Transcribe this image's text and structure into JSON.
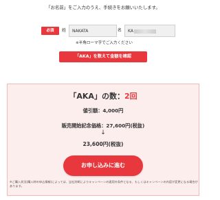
{
  "intro": "「お名前」をご入力のうえ、手続きをお願いいたします。",
  "name_form": {
    "required_badge": "必須",
    "sei_label": "姓",
    "sei_value": "NAKATA",
    "mei_label": "名",
    "mei_value": "KA",
    "note": "※半角ローマ字でご入力ください"
  },
  "count_button": "「AKA」を数えて金額を確認",
  "result": {
    "title_prefix": "「AKA」の数：",
    "count": "2回",
    "discount": "値引額：4,000円",
    "launch_price": "販売開始記念価格：27,600円(税抜)",
    "arrow": "↓",
    "final_price": "23,600円(税抜)",
    "apply_button": "お申し込みに進む",
    "disclaimer": "※ご購入状況(購入時の申込情報)によっては、当社判断によりキャンペーンの適用外条件となる、もしくはキャンペーンの内容が変更になる場合があります。"
  },
  "colors": {
    "accent": "#e8383d",
    "panel_bg": "#fdeeee",
    "panel_border": "#f2b8b8"
  }
}
